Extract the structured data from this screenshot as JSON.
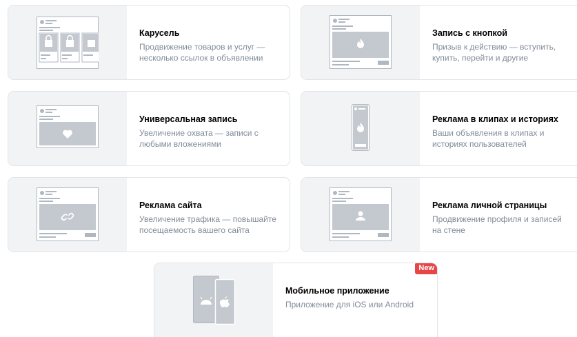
{
  "cards": [
    {
      "title": "Карусель",
      "desc1": "Продвижение товаров и услуг —",
      "desc2": "несколько ссылок в объявлении"
    },
    {
      "title": "Запись с кнопкой",
      "desc1": "Призыв к действию — вступить,",
      "desc2": "купить, перейти и другие"
    },
    {
      "title": "Универсальная запись",
      "desc1": "Увеличение охвата — записи с",
      "desc2": "любыми вложениями"
    },
    {
      "title": "Реклама в клипах и историях",
      "desc1": "Ваши объявления в клипах и",
      "desc2": "историях пользователей"
    },
    {
      "title": "Реклама сайта",
      "desc1": "Увеличение трафика — повышайте",
      "desc2": "посещаемость вашего сайта"
    },
    {
      "title": "Реклама личной страницы",
      "desc1": "Продвижение профиля и записей",
      "desc2": "на стене"
    },
    {
      "title": "Мобильное приложение",
      "desc1": "Приложение для iOS или Android",
      "desc2": "",
      "badge": "New"
    }
  ],
  "icons": [
    "carousel-post-icon",
    "button-post-icon",
    "heart-post-icon",
    "clip-story-icon",
    "link-post-icon",
    "profile-post-icon",
    "android-ios-phones-icon"
  ]
}
